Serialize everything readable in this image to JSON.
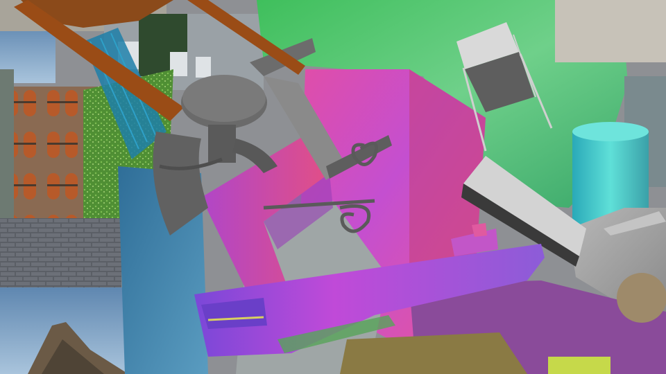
{
  "scene": {
    "kind": "synthetic-render-collage",
    "palette": {
      "sky": "#7fa6c7",
      "grass": "#5e9a3e",
      "green_blob": "#4fc36a",
      "magenta": "#d04bb8",
      "purple": "#8a4fd0",
      "cyan": "#3fc2c8",
      "gray_furniture": "#6e6e6e",
      "wood": "#9a4a14",
      "blue_panel": "#3f7fa6",
      "stone": "#9b9b9b",
      "brick": "#8a6a52"
    },
    "objects": [
      "wooden-chair-legs",
      "teal-wire-basket",
      "gray-round-stool",
      "gray-ornate-bench",
      "metal-frame-chair",
      "magenta-textured-box",
      "purple-ship-model",
      "cyan-cylinder",
      "gray-stone-block",
      "building-facade-panel",
      "mountain-photo-panel",
      "street-photo-panel",
      "brick-wall-panel"
    ]
  }
}
